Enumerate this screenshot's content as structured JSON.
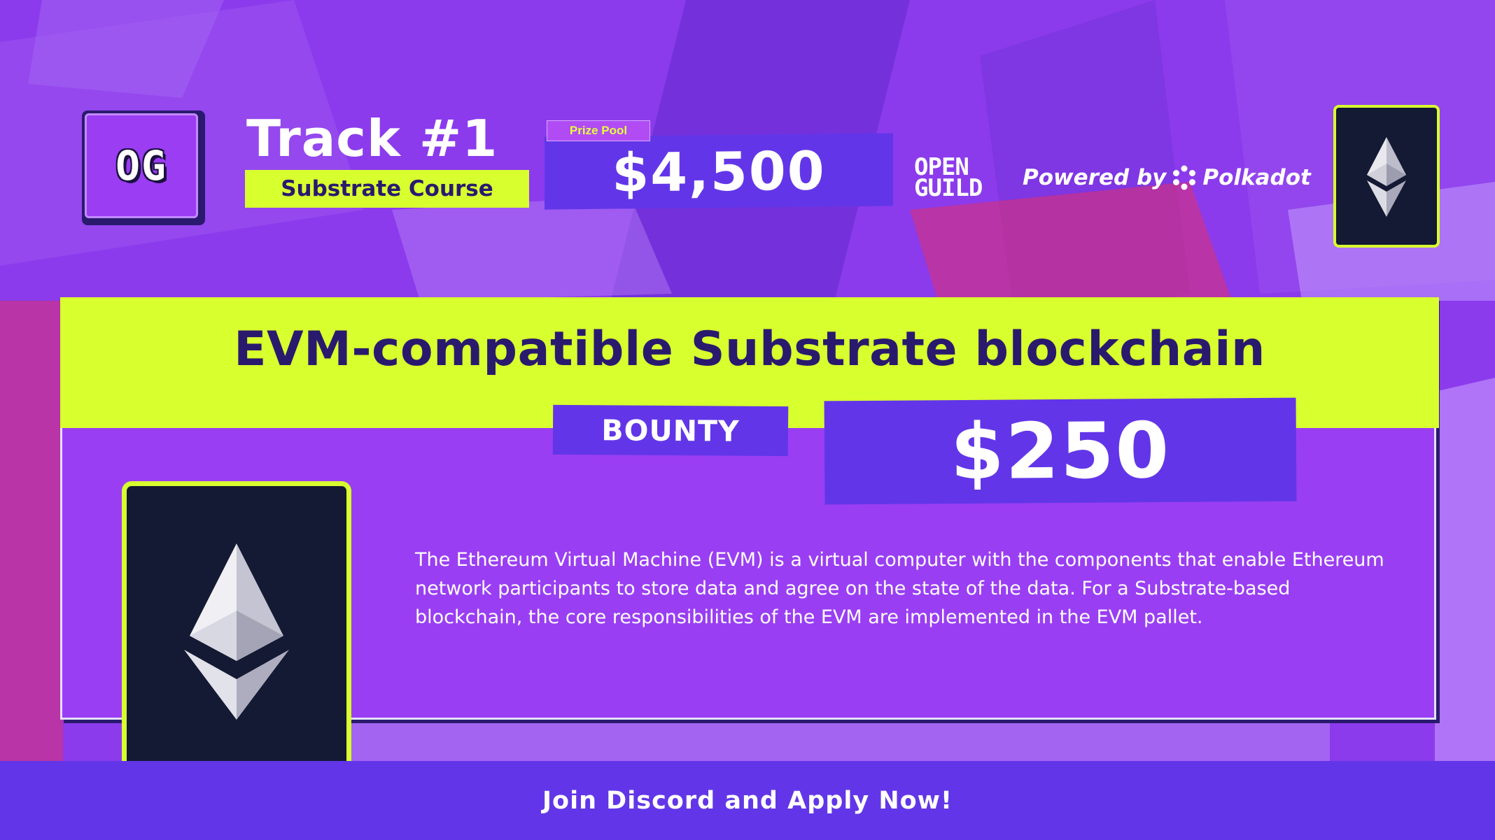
{
  "header": {
    "logo_text": "OG",
    "track_title": "Track #1",
    "course_label": "Substrate Course",
    "prize_pool_label": "Prize Pool",
    "prize_pool_amount": "$4,500",
    "org_name_line1": "OPEN",
    "org_name_line2": "GUILD",
    "powered_by_label": "Powered by",
    "powered_by_brand": "Polkadot"
  },
  "card": {
    "headline": "EVM-compatible Substrate blockchain",
    "bounty_label": "BOUNTY",
    "bounty_amount": "$250",
    "description": "The Ethereum Virtual Machine (EVM) is a virtual computer with the components that enable Ethereum network participants to store data and agree on the state of the data. For a Substrate-based blockchain, the core responsibilities of the EVM are implemented in the EVM pallet."
  },
  "footer": {
    "cta_text": "Join Discord and Apply Now!"
  },
  "icons": {
    "header_icon": "ethereum-icon",
    "card_icon": "ethereum-icon",
    "brand_icon": "polkadot-icon"
  },
  "colors": {
    "background": "#8b3bec",
    "accent_lime": "#d8ff2e",
    "accent_indigo": "#6236e8",
    "dark_navy": "#141a33",
    "text_dark": "#2a1a6e"
  }
}
